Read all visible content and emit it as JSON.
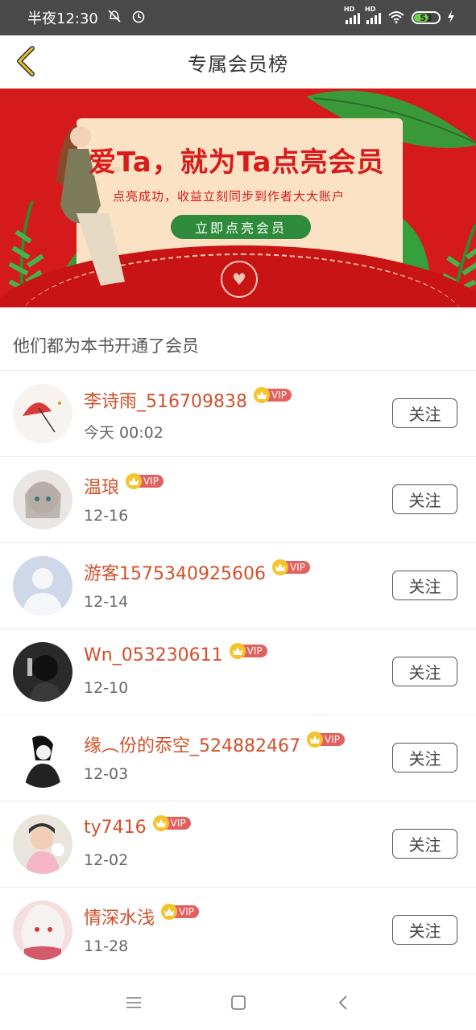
{
  "status_bar": {
    "time": "半夜12:30",
    "network_labels": [
      "HD",
      "HD"
    ],
    "battery": "53"
  },
  "header": {
    "title": "专属会员榜",
    "back_icon": "chevron-left-icon",
    "accent_color": "#c9a227"
  },
  "banner": {
    "headline": "爱Ta，就为Ta点亮会员",
    "subtitle": "点亮成功，收益立刻同步到作者大大账户",
    "cta_label": "立即点亮会员",
    "background_color": "#d41a1a"
  },
  "section_title": "他们都为本书开通了会员",
  "vip_label": "VIP",
  "follow_label": "关注",
  "members": [
    {
      "name": "李诗雨_516709838",
      "time": "今天 00:02",
      "avatar": "umbrella-illustration"
    },
    {
      "name": "温琅",
      "time": "12-16",
      "avatar": "anime-girl"
    },
    {
      "name": "游客1575340925606",
      "time": "12-14",
      "avatar": "default-avatar"
    },
    {
      "name": "Wn_053230611",
      "time": "12-10",
      "avatar": "dark-photo"
    },
    {
      "name": "缘︵份的忝空_524882467",
      "time": "12-03",
      "avatar": "bw-sketch"
    },
    {
      "name": "ty7416",
      "time": "12-02",
      "avatar": "child-photo"
    },
    {
      "name": "情深水浅",
      "time": "11-28",
      "avatar": "anime-pink"
    }
  ],
  "nav": {
    "menu_icon": "menu-icon",
    "home_icon": "home-square-icon",
    "back_icon": "back-triangle-icon"
  }
}
